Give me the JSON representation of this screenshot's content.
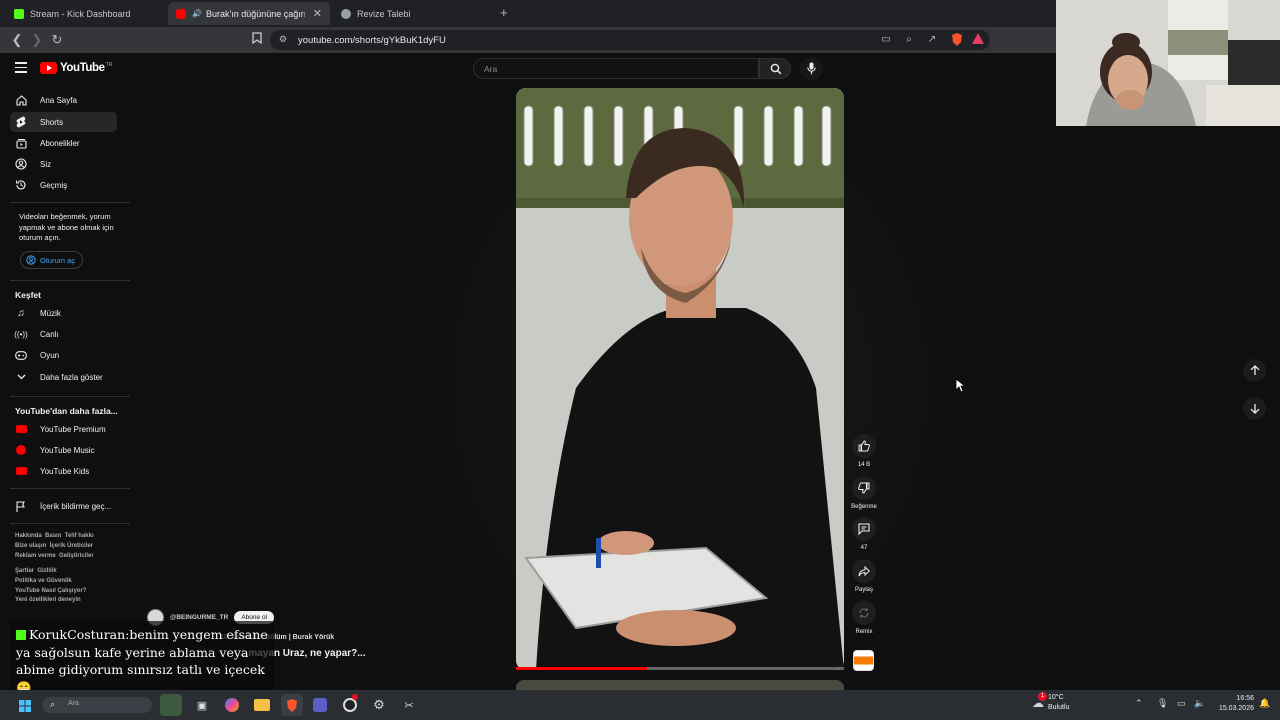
{
  "browser": {
    "tabs": [
      {
        "label": "Stream - Kick Dashboard",
        "favicon_color": "#53fc18"
      },
      {
        "label": "Burak'ın düğününe çağırılma",
        "favicon_color": "#ff0000"
      },
      {
        "label": "Revize Talebi",
        "favicon_color": "#9aa0a6"
      }
    ],
    "url": "youtube.com/shorts/gYkBuK1dyFU"
  },
  "youtube": {
    "logo_text": "YouTube",
    "logo_region": "TR",
    "search_placeholder": "Ara",
    "sidebar": {
      "main": [
        {
          "label": "Ana Sayfa",
          "icon": "home-icon"
        },
        {
          "label": "Shorts",
          "icon": "shorts-icon"
        },
        {
          "label": "Abonelikler",
          "icon": "subscriptions-icon"
        },
        {
          "label": "Siz",
          "icon": "user-icon"
        },
        {
          "label": "Geçmiş",
          "icon": "history-icon"
        }
      ],
      "signin_prompt": "Videoları beğenmek, yorum yapmak ve abone olmak için oturum açın.",
      "signin_button": "Oturum aç",
      "explore_title": "Keşfet",
      "explore": [
        {
          "label": "Müzik",
          "icon": "music-icon"
        },
        {
          "label": "Canlı",
          "icon": "live-icon"
        },
        {
          "label": "Oyun",
          "icon": "gaming-icon"
        },
        {
          "label": "Daha fazla göster",
          "icon": "chevron-down-icon"
        }
      ],
      "more_title": "YouTube'dan daha fazla...",
      "more": [
        {
          "label": "YouTube Premium"
        },
        {
          "label": "YouTube Music"
        },
        {
          "label": "YouTube Kids"
        }
      ],
      "report": "İçerik bildirme geç...",
      "footer1": [
        "Hakkında",
        "Basın",
        "Telif hakkı",
        "Bize ulaşın",
        "İçerik Üreticiler",
        "Reklam verme",
        "Geliştiriciler"
      ],
      "footer2": [
        "Şartlar",
        "Gizlilik",
        "Politika ve Güvenlik",
        "YouTube Nasıl Çalışıyor?",
        "Yeni özellikleri deneyin"
      ]
    },
    "short": {
      "channel": "@BEINGURME_TR",
      "subscribe_label": "Abone ol",
      "meta": "10. Tabak 10. Bölüm | Burak Yörük",
      "title": "...mayan Uraz, ne yapar?...",
      "progress": 0.4,
      "actions": {
        "like_count": "14 B",
        "dislike_label": "Beğenme",
        "comment_count": "47",
        "share_label": "Paylaş",
        "remix_label": "Remix"
      }
    }
  },
  "chat": {
    "username": "KorukCosturan:",
    "message": "benim yengem efsane ya sağolsun kafe yerine ablama veya abime gidiyorum sınırsız tatlı ve içecek 😁"
  },
  "taskbar": {
    "weather_temp": "10°C",
    "weather_desc": "Bulutlu",
    "weather_badge": "1",
    "time": "16:56",
    "date": "15.03.2026",
    "search_placeholder": "Ara"
  }
}
